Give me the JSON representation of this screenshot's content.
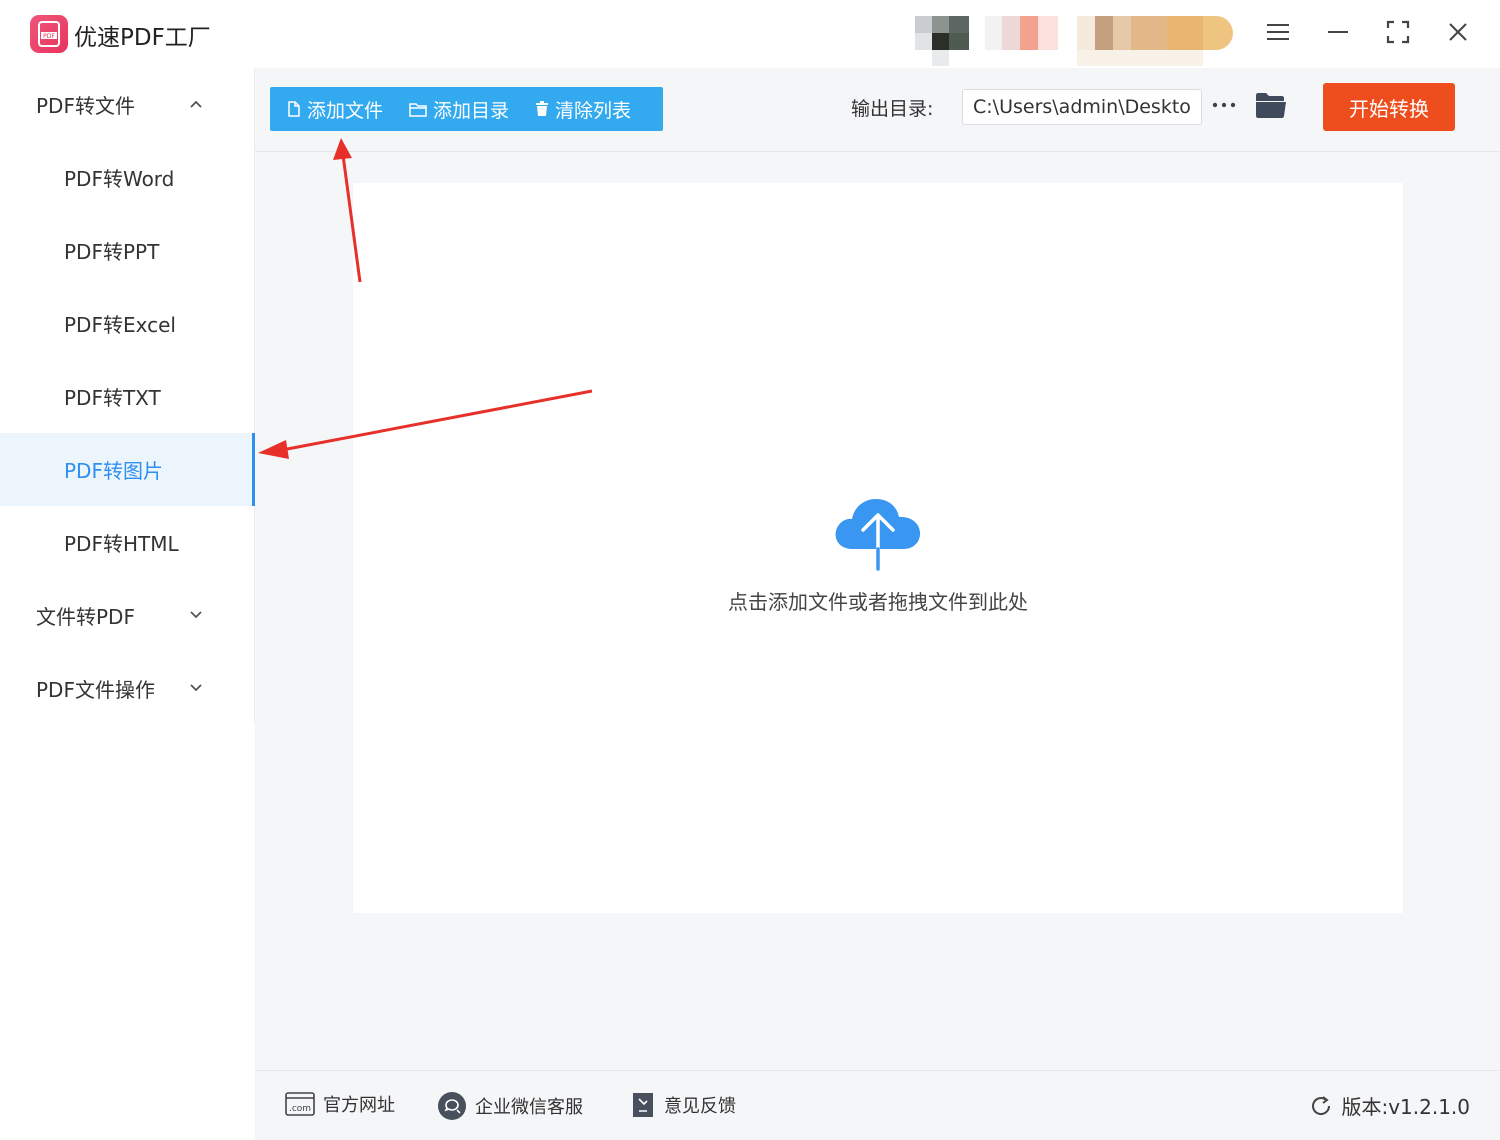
{
  "app": {
    "title": "优速PDF工厂"
  },
  "window": {
    "menu_icon": "menu-icon",
    "min_icon": "minimize-icon",
    "max_icon": "maximize-icon",
    "close_icon": "close-icon"
  },
  "sidebar": {
    "groups": [
      {
        "label": "PDF转文件",
        "expanded": true
      },
      {
        "label": "文件转PDF",
        "expanded": false
      },
      {
        "label": "PDF文件操作",
        "expanded": false
      }
    ],
    "items": [
      {
        "label": "PDF转Word"
      },
      {
        "label": "PDF转PPT"
      },
      {
        "label": "PDF转Excel"
      },
      {
        "label": "PDF转TXT"
      },
      {
        "label": "PDF转图片",
        "active": true
      },
      {
        "label": "PDF转HTML"
      }
    ]
  },
  "toolbar": {
    "add_file": "添加文件",
    "add_folder": "添加目录",
    "clear_list": "清除列表",
    "output_label": "输出目录:",
    "output_path": "C:\\Users\\admin\\Deskto",
    "start": "开始转换"
  },
  "dropzone": {
    "hint": "点击添加文件或者拖拽文件到此处"
  },
  "footer": {
    "website": "官方网址",
    "wechat": "企业微信客服",
    "feedback": "意见反馈",
    "version": "版本:v1.2.1.0"
  },
  "colors": {
    "accent": "#33aaf0",
    "start": "#ee4e1e",
    "active": "#2f8ff0",
    "annotation": "#e8302a"
  }
}
